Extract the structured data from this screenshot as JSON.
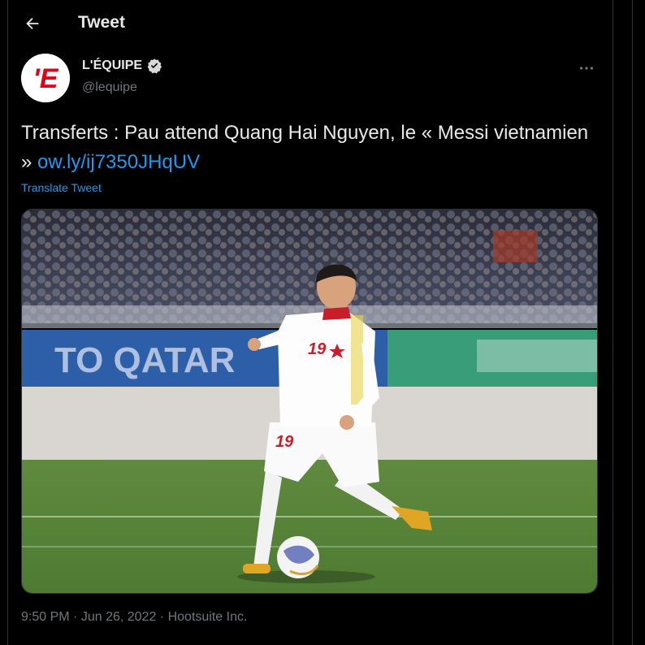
{
  "header": {
    "title": "Tweet",
    "back_icon": "arrow-left-icon"
  },
  "author": {
    "name": "L'ÉQUIPE",
    "handle": "@lequipe",
    "verified_icon": "verified-badge-icon",
    "avatar_text": "'E",
    "avatar_color": "#e2001a"
  },
  "tweet": {
    "text": "Transferts : Pau attend Quang Hai Nguyen, le « Messi vietnamien » ",
    "link": "ow.ly/ij7350JHqUV",
    "translate_label": "Translate Tweet",
    "timestamp": "9:50 PM",
    "date": "Jun 26, 2022",
    "source": "Hootsuite Inc.",
    "separator": "·"
  },
  "media": {
    "shirt_number": "19",
    "banner_text": "TO QATAR"
  },
  "colors": {
    "background": "#000000",
    "text": "#e7e9ea",
    "secondary": "#71767b",
    "accent": "#1d9bf0",
    "border": "#2f3336"
  }
}
